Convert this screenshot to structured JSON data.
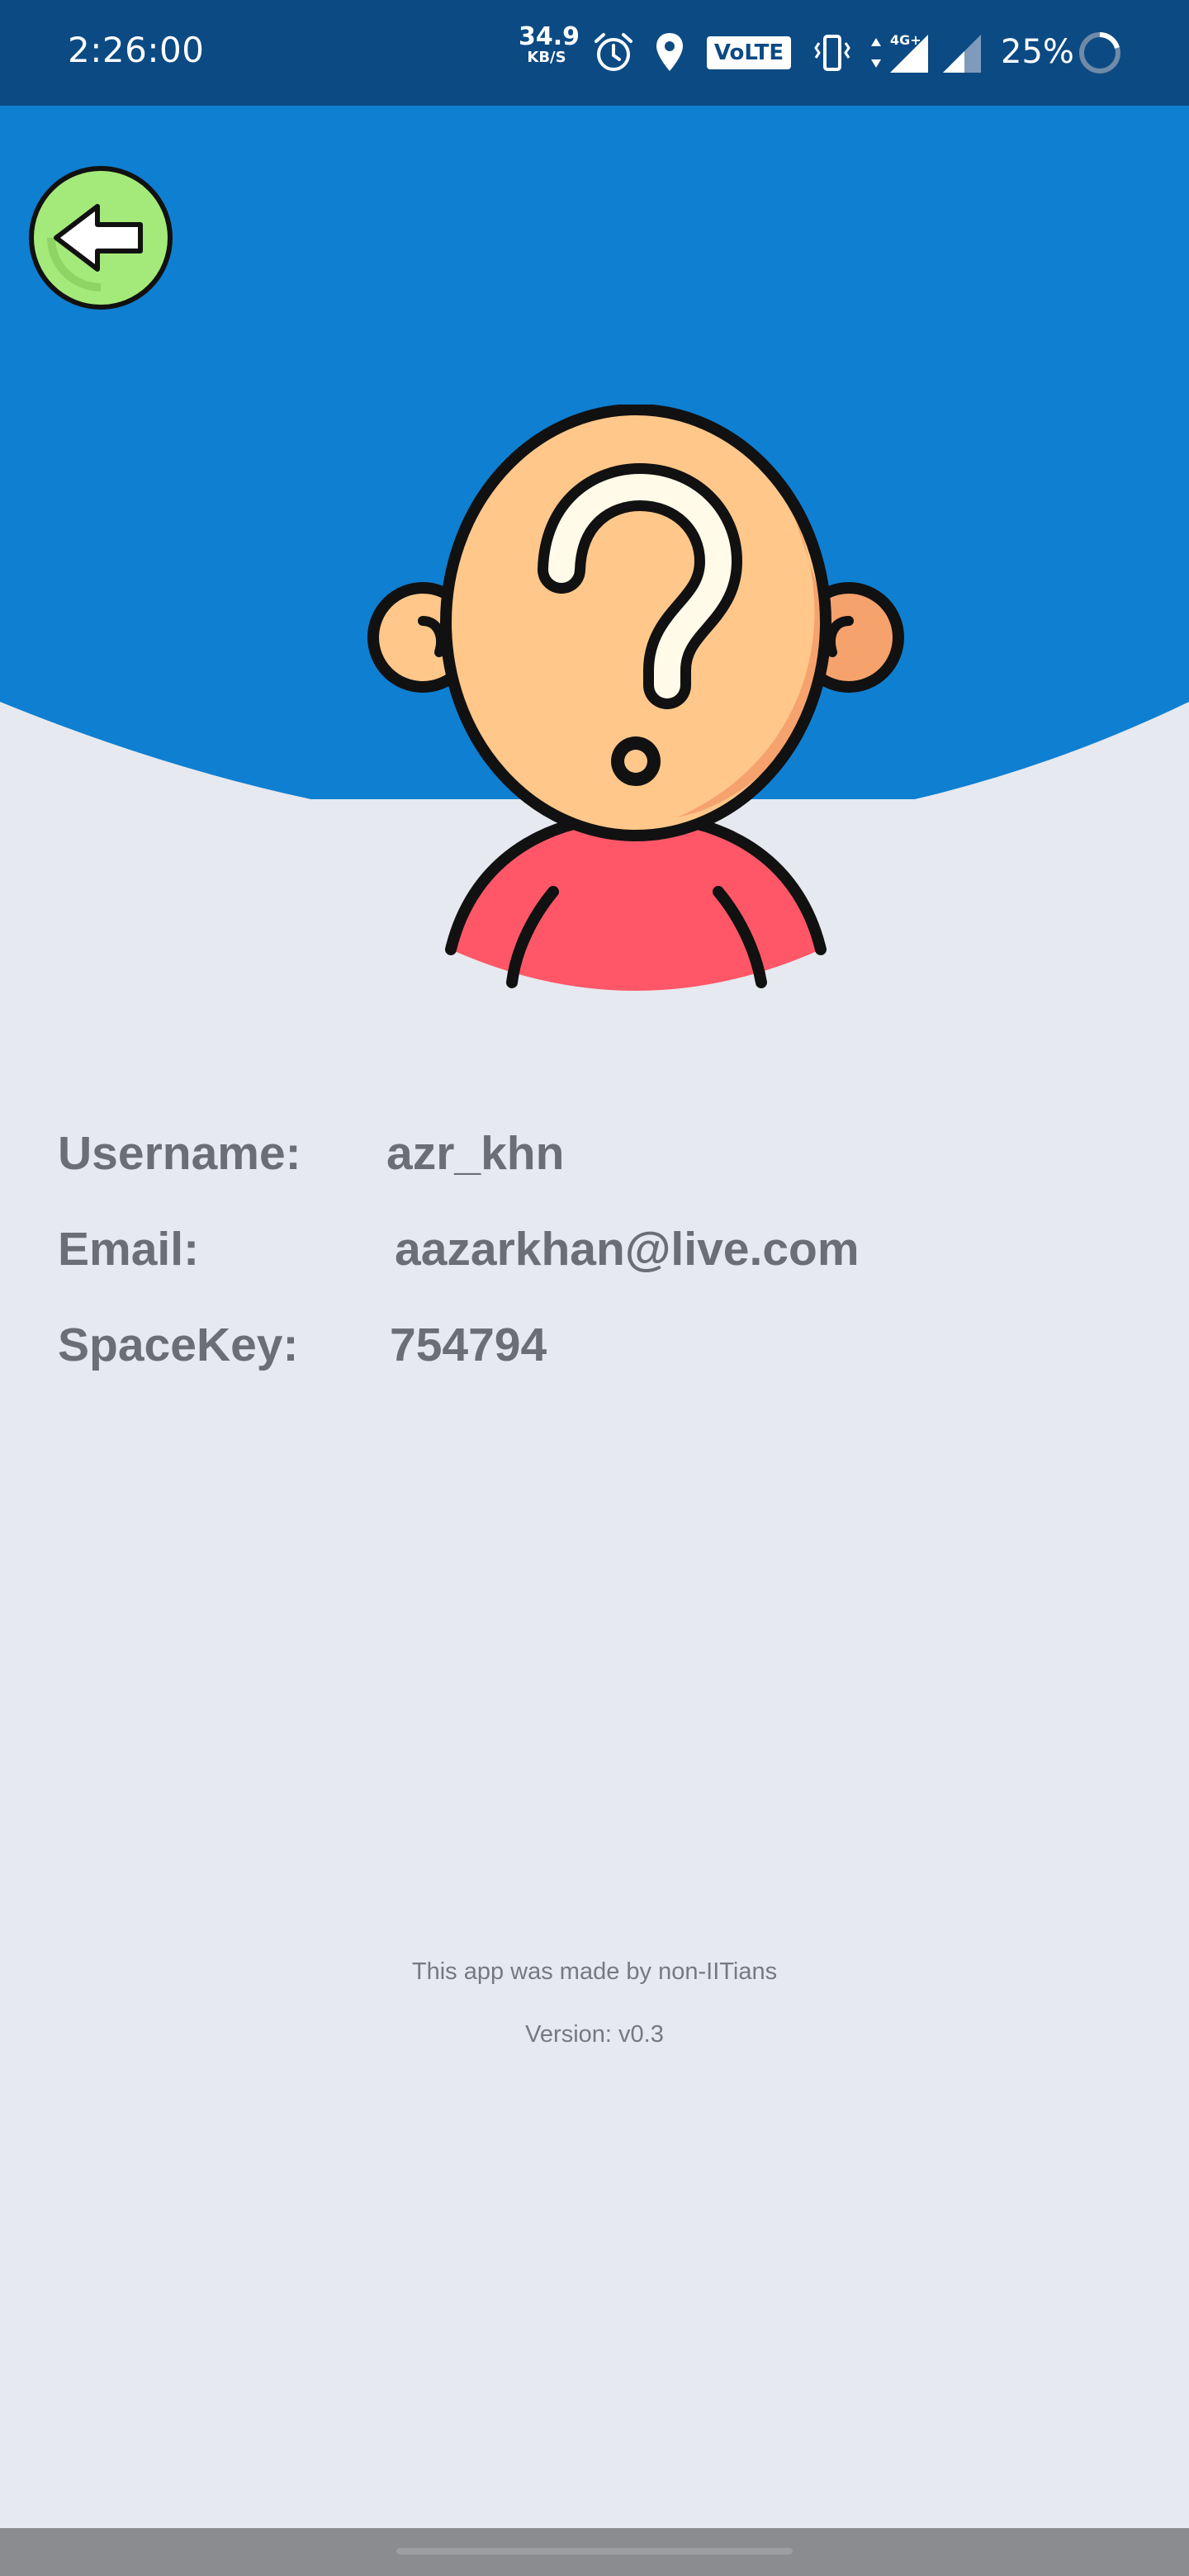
{
  "status_bar": {
    "time": "2:26:00",
    "net_speed_value": "34.9",
    "net_speed_unit": "KB/S",
    "volte": "VoLTE",
    "battery_percent": "25%"
  },
  "profile": {
    "username_label": "Username:",
    "username_value": "azr_khn",
    "email_label": "Email:",
    "email_value": "aazarkhan@live.com",
    "spacekey_label": "SpaceKey:",
    "spacekey_value": "754794"
  },
  "footer": {
    "credit": "This app was made by non-IITians",
    "version": "Version: v0.3"
  },
  "colors": {
    "header_blue": "#0f7fd1",
    "status_bar": "#0c4a83",
    "background": "#e6e9ef",
    "back_button_green": "#a4ea7a",
    "text_gray": "#6b6e74"
  },
  "icons": [
    "back-arrow-icon",
    "alarm-icon",
    "location-icon",
    "vibrate-icon",
    "data-arrows-icon",
    "signal-icon",
    "battery-ring-icon",
    "unknown-user-avatar"
  ]
}
